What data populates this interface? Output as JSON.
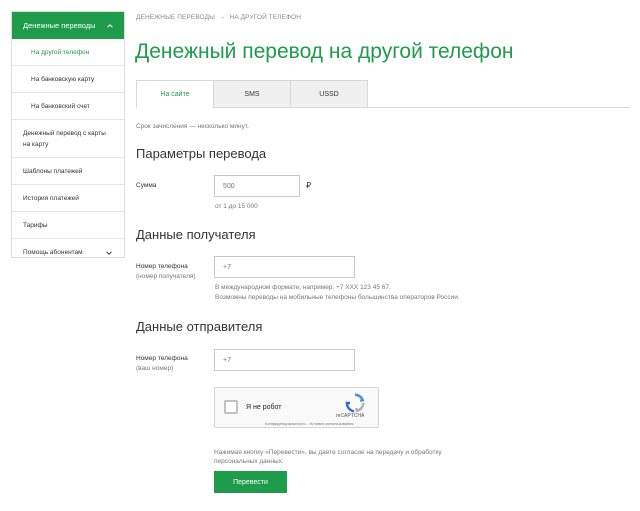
{
  "sidebar": {
    "header": "Денежные переводы",
    "sub_items": [
      "На другой телефон",
      "На банковскую карту",
      "На банковский счет"
    ],
    "items": [
      "Денежный перевод с карты на карту",
      "Шаблоны платежей",
      "История платежей",
      "Тарифы",
      "Помощь абонентам"
    ]
  },
  "breadcrumb": [
    "ДЕНЕЖНЫЕ ПЕРЕВОДЫ",
    "→",
    "НА ДРУГОЙ ТЕЛЕФОН"
  ],
  "title": "Денежный перевод на другой телефон",
  "tabs": [
    "На сайте",
    "SMS",
    "USSD"
  ],
  "hint": "Срок зачисления — несколько минут.",
  "transfer": {
    "heading": "Параметры перевода",
    "amount_label": "Сумма",
    "amount_placeholder": "500",
    "currency": "₽",
    "amount_note": "от 1 до 15 000"
  },
  "recipient": {
    "heading": "Данные получателя",
    "phone_label": "Номер телефона",
    "phone_sublabel": "(номер получателя)",
    "phone_placeholder": "+7",
    "note1": "В международном формате, например: +7 XXX 123 45 67.",
    "note2": "Возможны переводы на мобильные телефоны большинства операторов России."
  },
  "sender": {
    "heading": "Данные отправителя",
    "phone_label": "Номер телефона",
    "phone_sublabel": "(ваш номер)",
    "phone_placeholder": "+7"
  },
  "captcha": {
    "label": "Я не робот",
    "brand": "reCAPTCHA",
    "links": "Конфиденциальность - Условия использования"
  },
  "consent": "Нажимая кнопку «Перевести», вы даете согласие на передачу и обработку персональных данных.",
  "submit_label": "Перевести",
  "colors": {
    "accent": "#1e9c4c"
  }
}
